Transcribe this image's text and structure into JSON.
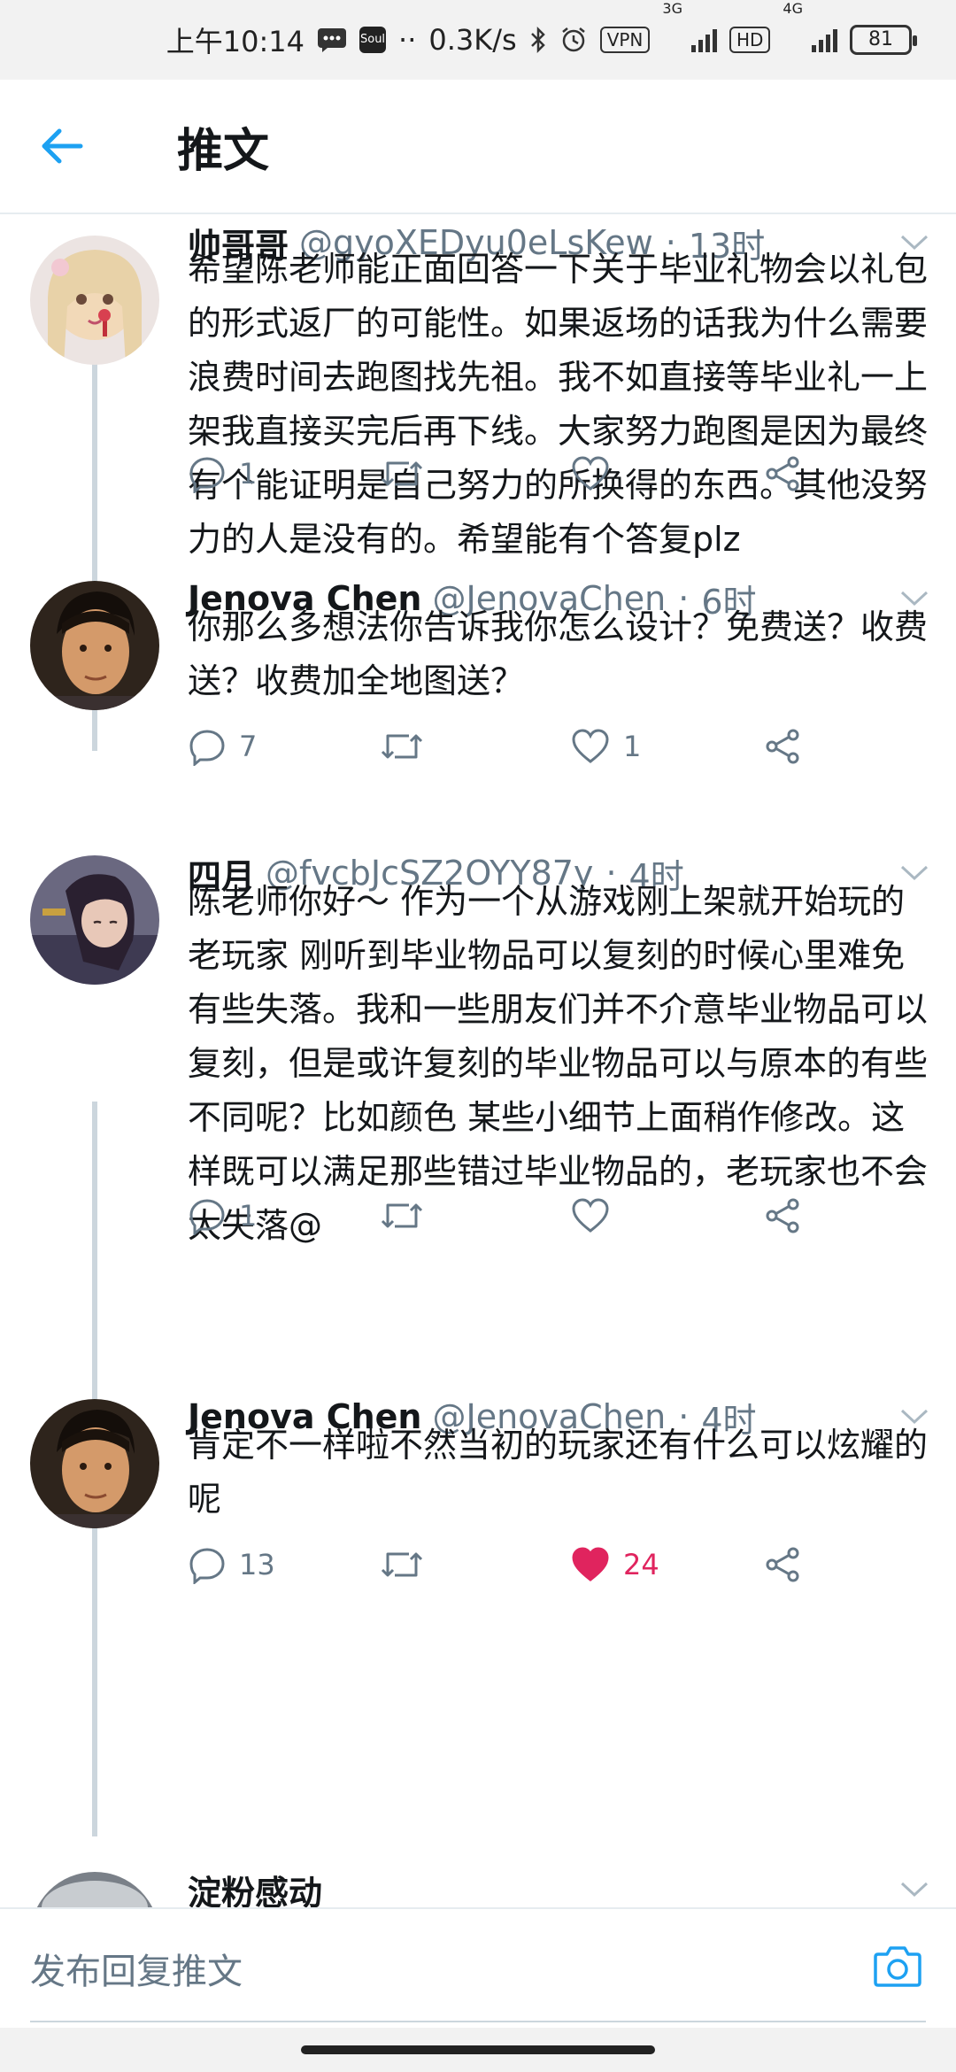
{
  "status_bar": {
    "time": "上午10:14",
    "net_speed": "0.3K/s",
    "vpn": "VPN",
    "net1": "3G",
    "hd": "HD",
    "net2": "4G",
    "battery": "81",
    "app_label": "Soul"
  },
  "header": {
    "title": "推文"
  },
  "tweets": [
    {
      "name": "帅哥哥",
      "handle": "@gyoXEDyu0eLsKew",
      "dot": "·",
      "time": "13时",
      "text": "希望陈老师能正面回答一下关于毕业礼物会以礼包的形式返厂的可能性。如果返场的话我为什么需要浪费时间去跑图找先祖。我不如直接等毕业礼一上架我直接买完后再下线。大家努力跑图是因为最终有个能证明是自己努力的所换得的东西。其他没努力的人是没有的。希望能有个答复plz",
      "replies": "1",
      "retweets": "",
      "likes": "",
      "liked": false
    },
    {
      "name": "Jenova Chen",
      "handle": "@JenovaChen",
      "dot": "·",
      "time": "6时",
      "text": "你那么多想法你告诉我你怎么设计？免费送？收费送？收费加全地图送？",
      "replies": "7",
      "retweets": "",
      "likes": "1",
      "liked": false
    },
    {
      "name": "四月",
      "handle": "@fvcbJcSZ2OYY87y",
      "dot": "·",
      "time": "4时",
      "text": "陈老师你好～ 作为一个从游戏刚上架就开始玩的老玩家 刚听到毕业物品可以复刻的时候心里难免有些失落。我和一些朋友们并不介意毕业物品可以复刻，但是或许复刻的毕业物品可以与原本的有些不同呢？比如颜色 某些小细节上面稍作修改。这样既可以满足那些错过毕业物品的，老玩家也不会太失落@",
      "replies": "1",
      "retweets": "",
      "likes": "",
      "liked": false
    },
    {
      "name": "Jenova Chen",
      "handle": "@JenovaChen",
      "dot": "·",
      "time": "4时",
      "text": "肯定不一样啦不然当初的玩家还有什么可以炫耀的呢",
      "replies": "13",
      "retweets": "",
      "likes": "24",
      "liked": true
    }
  ],
  "partial_tweet": {
    "name": "淀粉感动"
  },
  "reply_bar": {
    "placeholder": "发布回复推文"
  },
  "colors": {
    "accent": "#1da1f2",
    "like_active": "#e0245e",
    "secondary_text": "#657786",
    "thread_line": "#ccd6dd"
  }
}
